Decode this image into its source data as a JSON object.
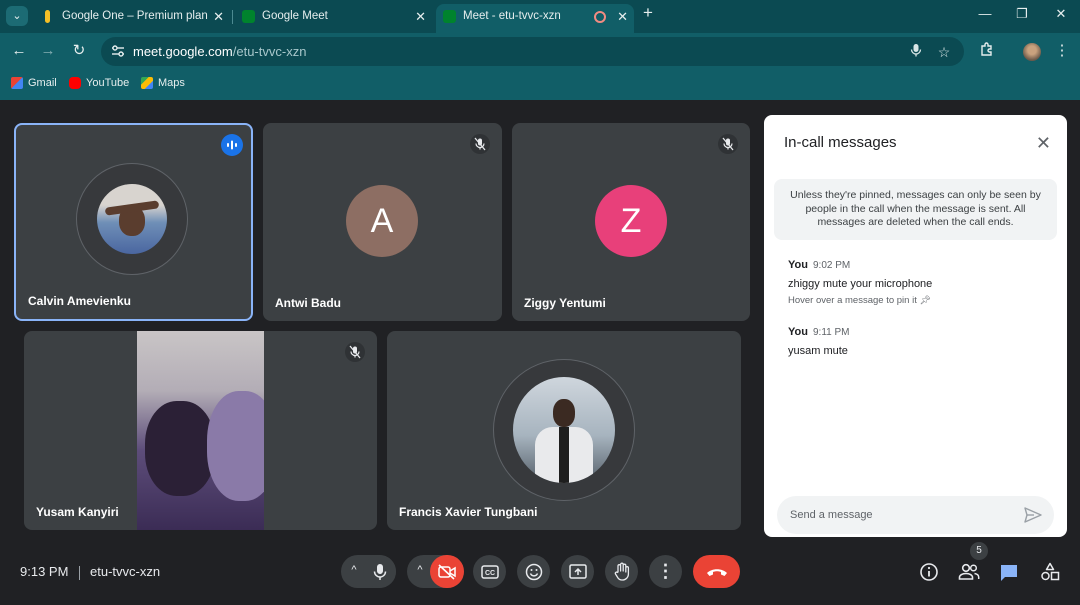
{
  "browser": {
    "tabs": [
      {
        "title": "Google One – Premium plan",
        "active": false
      },
      {
        "title": "Google Meet",
        "active": false
      },
      {
        "title": "Meet - etu-tvvc-xzn",
        "active": true
      }
    ],
    "url_host": "meet.google.com",
    "url_path": "/etu-tvvc-xzn",
    "bookmarks": [
      "Gmail",
      "YouTube",
      "Maps"
    ],
    "colors": {
      "frame": "#0b4a52",
      "toolbar": "#115e67"
    }
  },
  "meeting": {
    "participants": [
      {
        "name": "Calvin Amevienku",
        "type": "photo",
        "speaking": true
      },
      {
        "name": "Antwi Badu",
        "type": "letter",
        "letter": "A",
        "color": "#8d6e63",
        "muted": true
      },
      {
        "name": "Ziggy Yentumi",
        "type": "letter",
        "letter": "Z",
        "color": "#e8407a",
        "muted": true
      },
      {
        "name": "Yusam Kanyiri",
        "type": "video",
        "muted": true
      },
      {
        "name": "Francis Xavier Tungbani",
        "type": "photo"
      }
    ],
    "speaking_color": "#8ab4f8"
  },
  "chat": {
    "title": "In-call messages",
    "notice": "Unless they're pinned, messages can only be seen by people in the call when the message is sent. All messages are deleted when the call ends.",
    "messages": [
      {
        "sender": "You",
        "time": "9:02 PM",
        "text": "zhiggy mute your microphone",
        "hint": "Hover over a message to pin it"
      },
      {
        "sender": "You",
        "time": "9:11 PM",
        "text": "yusam mute"
      }
    ],
    "placeholder": "Send a message"
  },
  "bottom_bar": {
    "time": "9:13 PM",
    "meeting_code": "etu-tvvc-xzn",
    "people_count": "5",
    "icons": [
      "mic-icon",
      "camera-off-icon",
      "captions-icon",
      "emoji-icon",
      "present-icon",
      "raise-hand-icon",
      "more-options-icon",
      "end-call-icon",
      "info-icon",
      "people-icon",
      "chat-icon",
      "activities-icon"
    ],
    "colors": {
      "camera_off": "#ea4335",
      "end_call": "#ea4335",
      "chat_active": "#8ab4f8"
    }
  }
}
